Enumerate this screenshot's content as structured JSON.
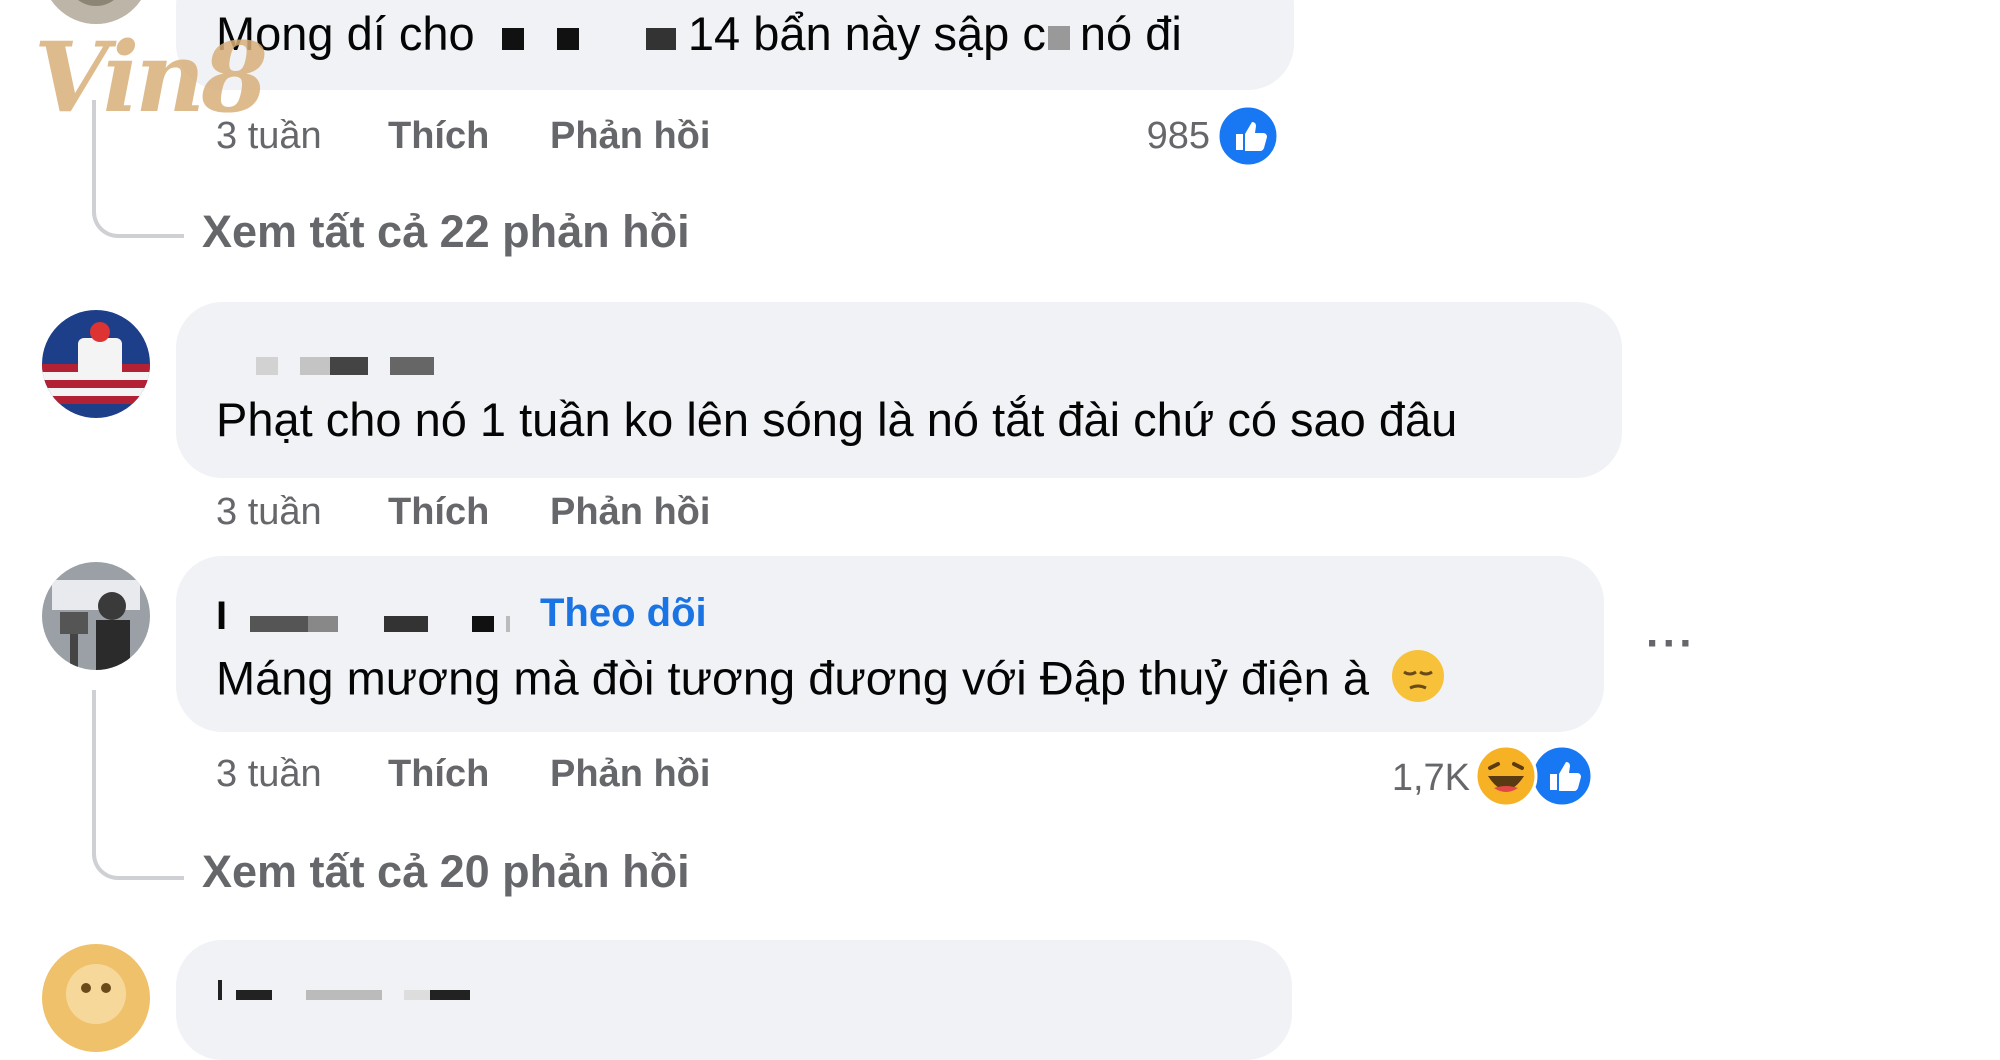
{
  "watermark": {
    "text": "Vin8"
  },
  "comments": [
    {
      "text": "Mong dí cho",
      "text_after": "14 bẩn này sập c",
      "text_tail": "nó đi",
      "time": "3 tuần",
      "like_label": "Thích",
      "reply_label": "Phản hồi",
      "reaction_count": "985",
      "reaction_icons": [
        "like-reaction-icon"
      ],
      "view_replies": "Xem tất cả 22 phản hồi"
    },
    {
      "text": "Phạt cho nó 1 tuần ko lên sóng là nó tắt đài chứ có sao đâu",
      "time": "3 tuần",
      "like_label": "Thích",
      "reply_label": "Phản hồi"
    },
    {
      "author_initial": "I",
      "follow_label": "Theo dõi",
      "text": "Máng mương mà đòi tương đương với Đập thuỷ điện à",
      "emoji": "pensive-face-emoji",
      "time": "3 tuần",
      "like_label": "Thích",
      "reply_label": "Phản hồi",
      "reaction_count": "1,7K",
      "reaction_icons": [
        "haha-reaction-icon",
        "like-reaction-icon"
      ],
      "view_replies": "Xem tất cả 20 phản hồi",
      "more_label": "···"
    }
  ],
  "colors": {
    "bubble": "#f0f2f5",
    "meta": "#65676b",
    "link": "#1b74e4",
    "like": "#1877f2",
    "text": "#050505"
  }
}
